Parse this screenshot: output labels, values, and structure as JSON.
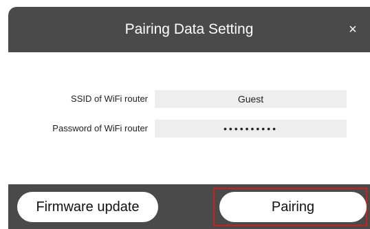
{
  "dialog": {
    "title": "Pairing Data Setting",
    "close_label": "×"
  },
  "form": {
    "ssid": {
      "label": "SSID of WiFi router",
      "value": "Guest"
    },
    "password": {
      "label": "Password of WiFi router",
      "value": "••••••••••"
    }
  },
  "footer": {
    "firmware_button": "Firmware update",
    "pairing_button": "Pairing"
  },
  "colors": {
    "header_bg": "#4a4a4a",
    "field_bg": "#eeeeee",
    "highlight": "#cc1f1f"
  }
}
